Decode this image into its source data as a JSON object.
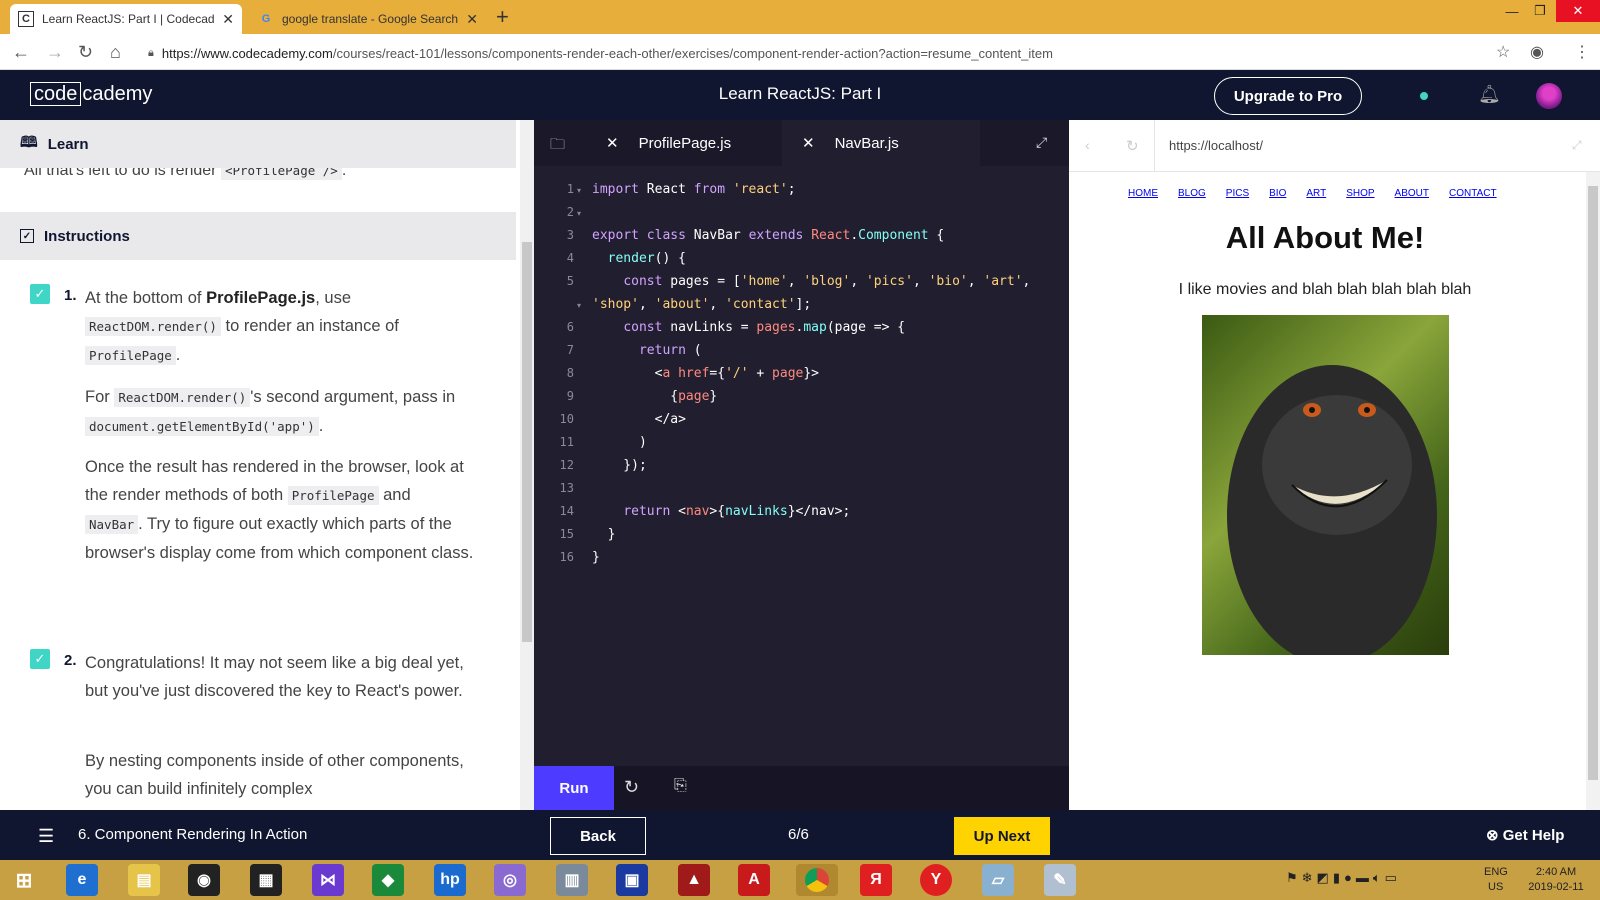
{
  "browser": {
    "tabs": [
      {
        "title": "Learn ReactJS: Part I | Codecademy",
        "favicon": "C",
        "close": "✕"
      },
      {
        "title": "google translate - Google Search",
        "favicon": "G",
        "close": "✕"
      }
    ],
    "new_tab": "+",
    "url_host": "https://www.codecademy.com",
    "url_path": "/courses/react-101/lessons/components-render-each-other/exercises/component-render-action?action=resume_content_item"
  },
  "header": {
    "logo_code": "code",
    "logo_rest": "cademy",
    "title": "Learn ReactJS: Part I",
    "upgrade": "Upgrade to Pro"
  },
  "learn": {
    "label": "Learn",
    "cut_text_before": "All that's left to do is render ",
    "cut_code": "<ProfilePage />",
    "cut_text_after": "."
  },
  "instructions": {
    "label": "Instructions",
    "step1": {
      "num": "1.",
      "p1_a": "At the bottom of ",
      "p1_file": "ProfilePage.js",
      "p1_b": ", use",
      "p1_code1": "ReactDOM.render()",
      "p1_c": " to render an instance of",
      "p1_code2": "ProfilePage",
      "p1_d": ".",
      "p2_a": "For ",
      "p2_code1": "ReactDOM.render()",
      "p2_b": "'s second argument, pass in",
      "p2_code2": "document.getElementById('app')",
      "p2_c": ".",
      "p3_a": "Once the result has rendered in the browser, look at the render methods of both ",
      "p3_code1": "ProfilePage",
      "p3_b": " and",
      "p3_code2": "NavBar",
      "p3_c": ". Try to figure out exactly which parts of the browser's display come from which component class."
    },
    "step2": {
      "num": "2.",
      "p1": "Congratulations! It may not seem like a big deal yet, but you've just discovered the key to React's power.",
      "p2": "By nesting components inside of other components, you can build infinitely complex"
    }
  },
  "editor": {
    "tabs": [
      "ProfilePage.js",
      "NavBar.js"
    ],
    "tab_close": "✕",
    "line_numbers": [
      "1",
      "2",
      "3",
      "4",
      "5",
      "",
      "6",
      "7",
      "8",
      "9",
      "10",
      "11",
      "12",
      "13",
      "14",
      "15",
      "16"
    ],
    "run": "Run"
  },
  "preview": {
    "url": "https://localhost/",
    "nav": [
      "HOME",
      "BLOG",
      "PICS",
      "BIO",
      "ART",
      "SHOP",
      "ABOUT",
      "CONTACT"
    ],
    "heading": "All About Me!",
    "text": "I like movies and blah blah blah blah blah"
  },
  "footer": {
    "lesson": "6. Component Rendering In Action",
    "back": "Back",
    "progress": "6/6",
    "up_next": "Up Next",
    "help": "Get Help"
  },
  "taskbar": {
    "lang1": "ENG",
    "lang2": "US",
    "time": "2:40 AM",
    "date": "2019-02-11"
  },
  "colors": {
    "tab_strip": "#e8ae3c",
    "cc_navy": "#10162f",
    "editor_bg": "#211e2f",
    "run_button": "#4d3bff",
    "up_next": "#ffd300",
    "check": "#3fd6c7"
  }
}
